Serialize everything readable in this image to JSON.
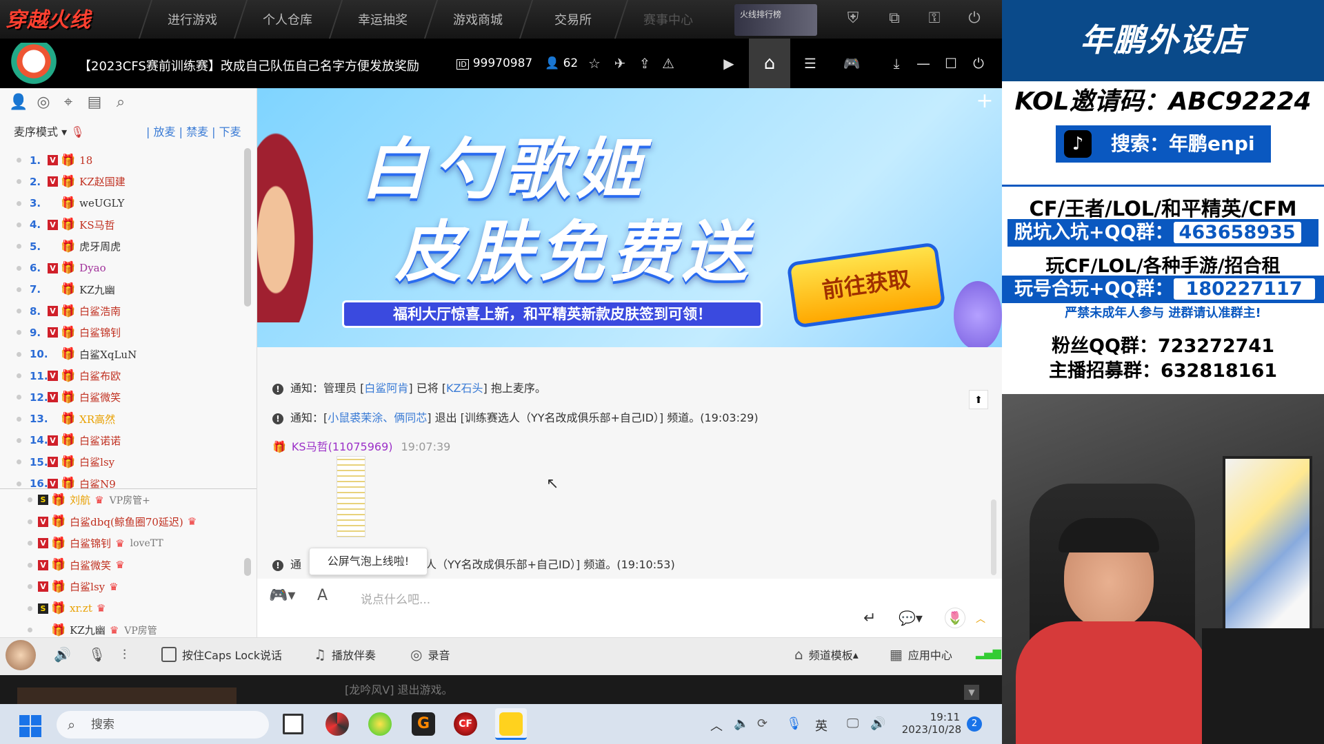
{
  "game_nav": {
    "logo": "穿越火线",
    "items": [
      "进行游戏",
      "个人仓库",
      "幸运抽奖",
      "游戏商城",
      "交易所",
      "赛事中心"
    ],
    "promo": "火线排行榜"
  },
  "channel": {
    "title": "【2023CFS赛前训练赛】改成自己队伍自己名字方便发放奖励",
    "id_label": "ID",
    "id": "99970987",
    "members": "62"
  },
  "left_panel": {
    "mode": "麦序模式",
    "actions": [
      "放麦",
      "禁麦",
      "下麦"
    ],
    "queue": [
      {
        "rank": "1.",
        "name": "18",
        "color": "#c03020",
        "v": true
      },
      {
        "rank": "2.",
        "name": "KZ赵国建",
        "color": "#c03020",
        "v": true
      },
      {
        "rank": "3.",
        "name": "weUGLY",
        "color": "#333",
        "v": false
      },
      {
        "rank": "4.",
        "name": "KS马哲",
        "color": "#c03020",
        "v": true
      },
      {
        "rank": "5.",
        "name": "虎牙周虎",
        "color": "#333",
        "v": false
      },
      {
        "rank": "6.",
        "name": "Dyao",
        "color": "#a0309a",
        "v": true
      },
      {
        "rank": "7.",
        "name": "KZ九幽",
        "color": "#333",
        "v": false
      },
      {
        "rank": "8.",
        "name": "白鲨浩南",
        "color": "#c03020",
        "v": true
      },
      {
        "rank": "9.",
        "name": "白鲨锦钊",
        "color": "#c03020",
        "v": true
      },
      {
        "rank": "10.",
        "name": "白鲨XqLuN",
        "color": "#333",
        "v": false
      },
      {
        "rank": "11.",
        "name": "白鲨布欧",
        "color": "#c03020",
        "v": true
      },
      {
        "rank": "12.",
        "name": "白鲨微笑",
        "color": "#c03020",
        "v": true
      },
      {
        "rank": "13.",
        "name": "XR高然",
        "color": "#e8a000",
        "v": false
      },
      {
        "rank": "14.",
        "name": "白鲨诺诺",
        "color": "#c03020",
        "v": true
      },
      {
        "rank": "15.",
        "name": "白鲨lsy",
        "color": "#c03020",
        "v": true
      },
      {
        "rank": "16.",
        "name": "白鲨N9",
        "color": "#c03020",
        "v": true
      }
    ],
    "members": [
      {
        "name": "刘航",
        "extra": "VP房管+",
        "color": "#e8a000"
      },
      {
        "name": "白鲨dbq(鲸鱼圈70延迟)",
        "extra": "",
        "color": "#c03020"
      },
      {
        "name": "白鲨锦钊",
        "extra": "loveTT",
        "color": "#c03020"
      },
      {
        "name": "白鲨微笑",
        "extra": "",
        "color": "#c03020"
      },
      {
        "name": "白鲨lsy",
        "extra": "",
        "color": "#c03020"
      },
      {
        "name": "xr.zt",
        "extra": "",
        "color": "#e8a000"
      },
      {
        "name": "KZ九幽",
        "extra": "VP房管",
        "color": "#333"
      }
    ]
  },
  "banner": {
    "line1": "白勺歌姬",
    "line2": "皮肤免费送",
    "subtitle": "福利大厅惊喜上新，和平精英新款皮肤签到可领！",
    "button": "前往获取"
  },
  "chat": {
    "msg1": {
      "prefix": "通知：管理员 [",
      "admin": "白鲨阿肯",
      "mid": "] 已将 [",
      "target": "KZ石头",
      "suffix": "] 抱上麦序。"
    },
    "msg2": {
      "prefix": "通知：[",
      "users": "小鼠裘茉涂、俩同芯",
      "suffix": "] 退出 [训练赛选人（YY名改成俱乐部+自己ID）] 频道。(19:03:29)"
    },
    "msg3": {
      "user": "KS马哲(11075969)",
      "time": "19:07:39"
    },
    "msg4": {
      "prefix": "通",
      "suffix": "人（YY名改成俱乐部+自己ID）] 频道。(19:10:53)"
    },
    "tooltip": "公屏气泡上线啦!",
    "input_placeholder": "说点什么吧..."
  },
  "toolbar": {
    "caps": "按住Caps Lock说话",
    "music": "播放伴奏",
    "record": "录音",
    "template": "频道模板",
    "apps": "应用中心"
  },
  "game_log": "[龙吟风V] 退出游戏。",
  "taskbar": {
    "search": "搜索",
    "lang": "英",
    "time": "19:11",
    "date": "2023/10/28",
    "badge": "2"
  },
  "streamer": {
    "shop": "年鹏外设店",
    "kol": "KOL邀请码：ABC92224",
    "tiktok": "搜索：年鹏enpi",
    "line1": "CF/王者/LOL/和平精英/CFM",
    "qq1_label": "脱坑入坑+QQ群：",
    "qq1": "463658935",
    "line2": "玩CF/LOL/各种手游/招合租",
    "qq2_label": "玩号合玩+QQ群：",
    "qq2": "180227117",
    "warning": "严禁未成年人参与  进群请认准群主!",
    "fans": "粉丝QQ群：723272741",
    "anchor": "主播招募群：632818161"
  }
}
